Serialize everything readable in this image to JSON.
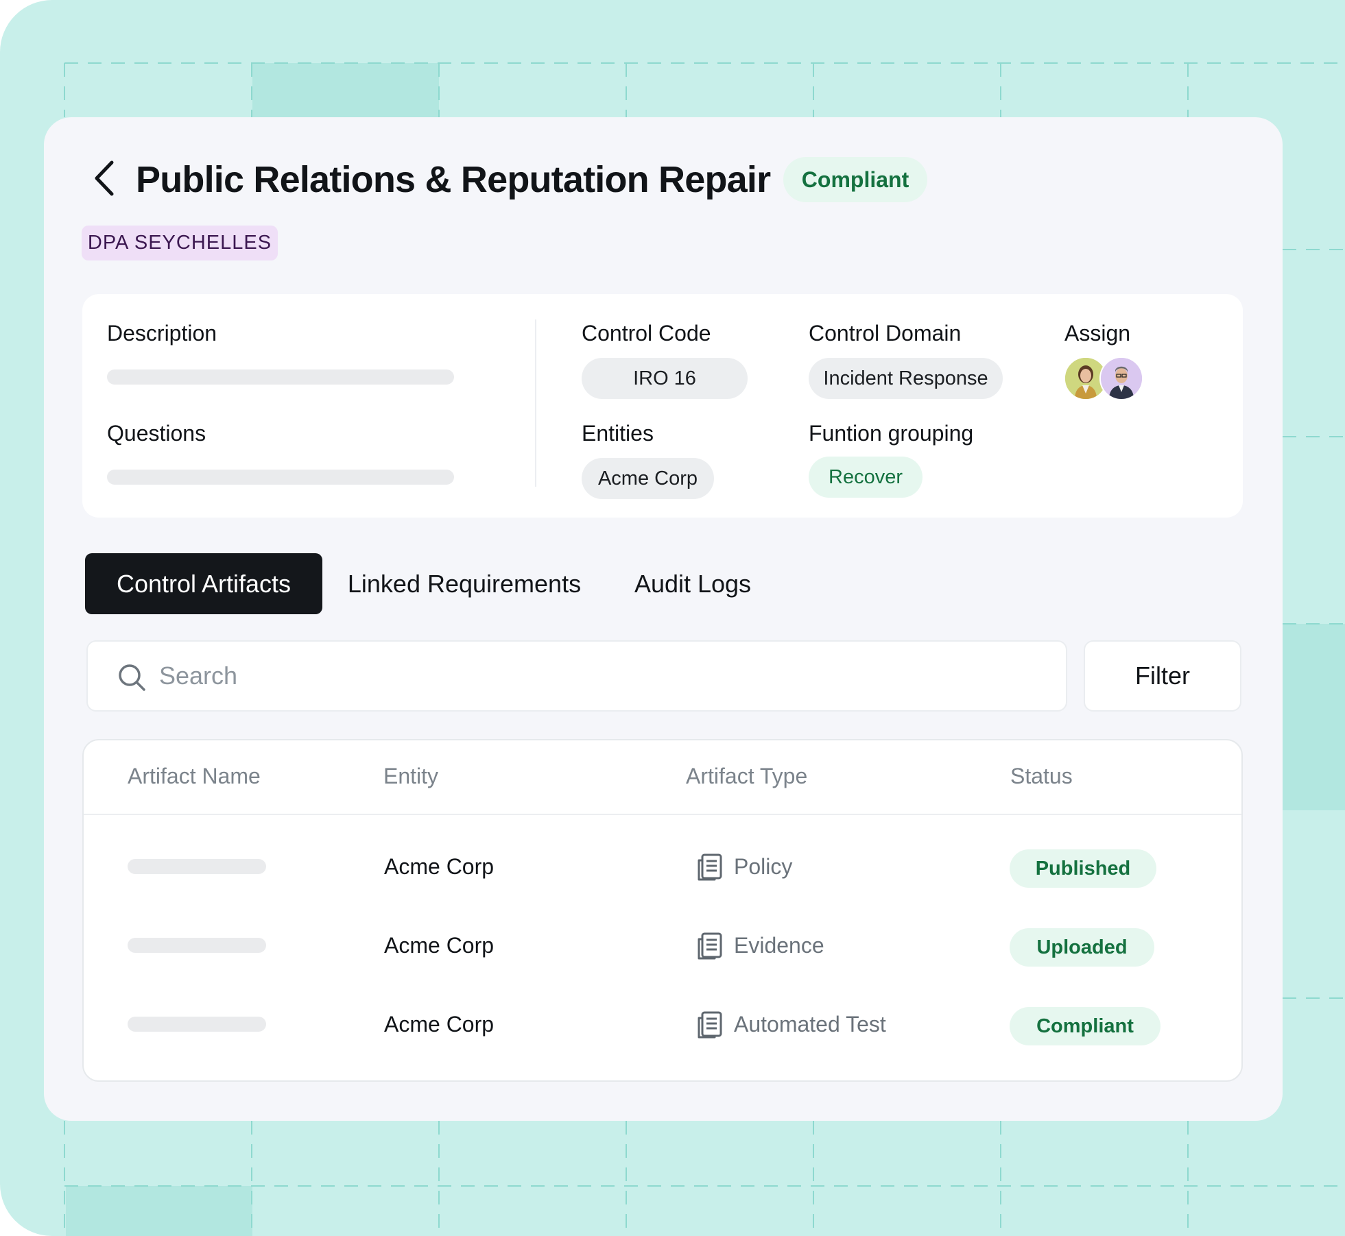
{
  "colors": {
    "background": "#c8efea",
    "card": "#f5f6fa",
    "accent_dark": "#14171b",
    "status_green_bg": "#e6f7ef",
    "status_green_text": "#14713f",
    "tag_purple_bg": "#efdff7",
    "tag_purple_text": "#3b1750"
  },
  "header": {
    "back_icon": "chevron-left-icon",
    "title": "Public Relations & Reputation Repair",
    "status": "Compliant",
    "framework_tag": "DPA SEYCHELLES"
  },
  "details": {
    "description_label": "Description",
    "questions_label": "Questions",
    "control_code_label": "Control Code",
    "control_code_value": "IRO 16",
    "control_domain_label": "Control Domain",
    "control_domain_value": "Incident Response",
    "assign_label": "Assign",
    "assignees": [
      {
        "icon": "woman-avatar"
      },
      {
        "icon": "man-avatar"
      }
    ],
    "entities_label": "Entities",
    "entities_value": "Acme Corp",
    "function_grouping_label": "Funtion grouping",
    "function_grouping_value": "Recover"
  },
  "tabs": [
    {
      "label": "Control Artifacts",
      "active": true
    },
    {
      "label": "Linked Requirements",
      "active": false
    },
    {
      "label": "Audit Logs",
      "active": false
    }
  ],
  "search": {
    "icon": "search-icon",
    "placeholder": "Search",
    "value": ""
  },
  "filter": {
    "label": "Filter"
  },
  "table": {
    "columns": [
      "Artifact Name",
      "Entity",
      "Artifact Type",
      "Status"
    ],
    "rows": [
      {
        "entity": "Acme Corp",
        "type_icon": "document-icon",
        "type": "Policy",
        "status": "Published"
      },
      {
        "entity": "Acme Corp",
        "type_icon": "document-icon",
        "type": "Evidence",
        "status": "Uploaded"
      },
      {
        "entity": "Acme Corp",
        "type_icon": "document-icon",
        "type": "Automated Test",
        "status": "Compliant"
      }
    ]
  }
}
